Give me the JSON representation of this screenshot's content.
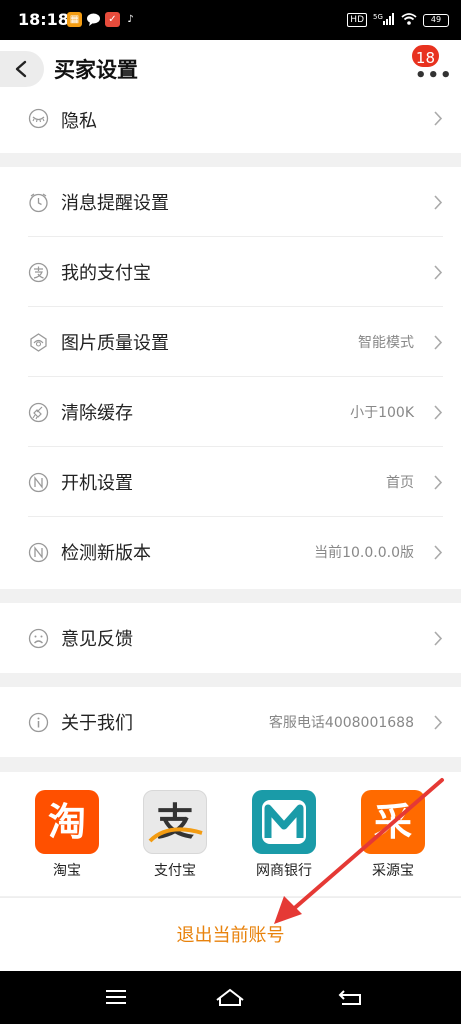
{
  "status_bar": {
    "time": "18:18",
    "network": "5G",
    "battery": "49",
    "hd_label": "HD"
  },
  "header": {
    "title": "买家设置",
    "badge_count": "18"
  },
  "settings": {
    "privacy": {
      "label": "隐私",
      "icon": "privacy-icon"
    },
    "notifications": {
      "label": "消息提醒设置",
      "icon": "clock-icon"
    },
    "alipay": {
      "label": "我的支付宝",
      "icon": "alipay-icon"
    },
    "image_quality": {
      "label": "图片质量设置",
      "value": "智能模式",
      "icon": "image-quality-icon"
    },
    "clear_cache": {
      "label": "清除缓存",
      "value": "小于100K",
      "icon": "broom-icon"
    },
    "startup": {
      "label": "开机设置",
      "value": "首页",
      "icon": "n-circle-icon"
    },
    "check_version": {
      "label": "检测新版本",
      "value": "当前10.0.0.0版",
      "icon": "n-circle-icon"
    },
    "feedback": {
      "label": "意见反馈",
      "icon": "sad-face-icon"
    },
    "about": {
      "label": "关于我们",
      "value": "客服电话4008001688",
      "icon": "info-icon"
    }
  },
  "apps": [
    {
      "name": "淘宝",
      "glyph": "淘",
      "color": "#ff5000"
    },
    {
      "name": "支付宝",
      "glyph": "支",
      "color": "#e9e9e9"
    },
    {
      "name": "网商银行",
      "glyph": "M",
      "color": "#1a9ba8"
    },
    {
      "name": "采源宝",
      "glyph": "采",
      "color": "#ff6a00"
    }
  ],
  "logout": {
    "label": "退出当前账号"
  },
  "colors": {
    "accent_orange": "#e8820c",
    "badge_red": "#e8321f",
    "annotation_arrow": "#e53935"
  }
}
